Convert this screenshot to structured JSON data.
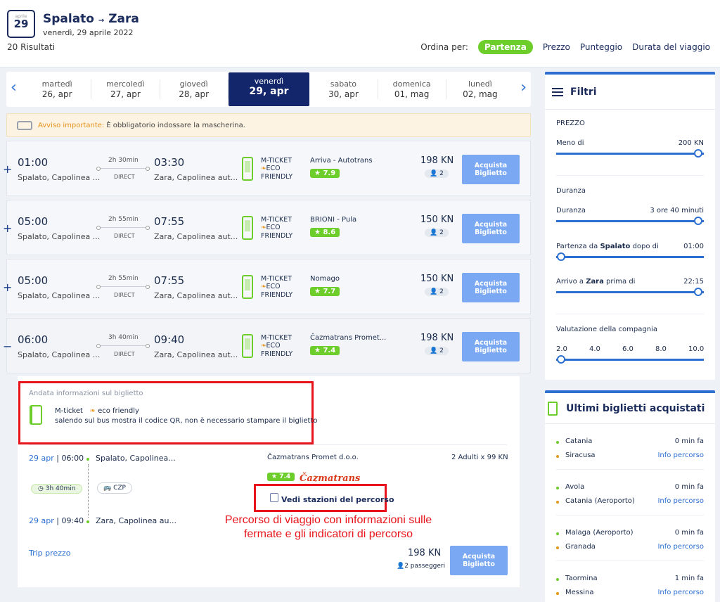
{
  "header": {
    "cal_month": "aprile",
    "cal_day": "29",
    "from": "Spalato",
    "arrow": "→",
    "to": "Zara",
    "date": "venerdì, 29 aprile 2022",
    "results": "20 Risultati",
    "sort_label": "Ordina per:",
    "sort_options": [
      "Partenza",
      "Prezzo",
      "Punteggio",
      "Durata del viaggio"
    ]
  },
  "days": [
    {
      "n": "martedì",
      "d": "26, apr"
    },
    {
      "n": "mercoledì",
      "d": "27, apr"
    },
    {
      "n": "giovedì",
      "d": "28, apr"
    },
    {
      "n": "venerdì",
      "d": "29, apr"
    },
    {
      "n": "sabato",
      "d": "30, apr"
    },
    {
      "n": "domenica",
      "d": "01, mag"
    },
    {
      "n": "lunedì",
      "d": "02, mag"
    }
  ],
  "warning": {
    "label": "Avviso importante:",
    "text": "È obbligatorio indossare la mascherina."
  },
  "trips": [
    {
      "toggle": "+",
      "dep": "01:00",
      "dep_station": "Spalato, Capolinea ...",
      "dur": "2h 30min",
      "direct": "DIRECT",
      "arr": "03:30",
      "arr_station": "Zara, Capolinea aut...",
      "mt1": "M-TICKET",
      "mt2": "ECO",
      "mt3": "FRIENDLY",
      "company": "Arriva - Autotrans",
      "rating": "★ 7.9",
      "price": "198 KN",
      "pax": "2",
      "buy": "Acquista Biglietto"
    },
    {
      "toggle": "+",
      "dep": "05:00",
      "dep_station": "Spalato, Capolinea ...",
      "dur": "2h 55min",
      "direct": "DIRECT",
      "arr": "07:55",
      "arr_station": "Zara, Capolinea aut...",
      "mt1": "M-TICKET",
      "mt2": "ECO",
      "mt3": "FRIENDLY",
      "company": "BRIONI - Pula",
      "rating": "★ 8.6",
      "price": "150 KN",
      "pax": "2",
      "buy": "Acquista Biglietto"
    },
    {
      "toggle": "+",
      "dep": "05:00",
      "dep_station": "Spalato, Capolinea ...",
      "dur": "2h 55min",
      "direct": "DIRECT",
      "arr": "07:55",
      "arr_station": "Zara, Capolinea aut...",
      "mt1": "M-TICKET",
      "mt2": "ECO",
      "mt3": "FRIENDLY",
      "company": "Nomago",
      "rating": "★ 7.7",
      "price": "150 KN",
      "pax": "2",
      "buy": "Acquista Biglietto"
    },
    {
      "toggle": "−",
      "dep": "06:00",
      "dep_station": "Spalato, Capolinea ...",
      "dur": "3h 40min",
      "direct": "DIRECT",
      "arr": "09:40",
      "arr_station": "Zara, Capolinea aut...",
      "mt1": "M-TICKET",
      "mt2": "ECO",
      "mt3": "FRIENDLY",
      "company": "Čazmatrans Promet...",
      "rating": "★ 7.4",
      "price": "198 KN",
      "pax": "2",
      "buy": "Acquista Biglietto"
    }
  ],
  "detail": {
    "info_title": "Andata informazioni sul biglietto",
    "mticket": "M-ticket",
    "eco": "eco friendly",
    "qr_text": "salendo sul bus mostra il codice QR, non è necessario stampare il biglietto",
    "dep_date": "29 apr",
    "dep_time": "06:00",
    "dep_station": "Spalato, Capolinea...",
    "duration": "3h 40min",
    "bus": "CZP",
    "arr_date": "29 apr",
    "arr_time": "09:40",
    "arr_station": "Zara, Capolinea au...",
    "company": "Čazmatrans Promet d.o.o.",
    "adults": "2 Adulti x 99 KN",
    "rating": "★ 7.4",
    "logo": "Čazmatrans",
    "stations": "Vedi stazioni del percorso",
    "annotation": "Percorso di viaggio con informazioni sulle fermate e gli indicatori di percorso",
    "trip_price_label": "Trip prezzo",
    "total": "198 KN",
    "passengers": "2 passeggeri",
    "buy": "Acquista Biglietto"
  },
  "filters": {
    "title": "Filtri",
    "price_section": "PREZZO",
    "price_label": "Meno di",
    "price_value": "200 KN",
    "duration_section": "Duranza",
    "duration_label": "Duranza",
    "duration_value": "3 ore 40 minuti",
    "dep_label_a": "Partenza da ",
    "dep_city": "Spalato",
    "dep_label_b": " dopo di",
    "dep_value": "01:00",
    "arr_label_a": "Arrivo a ",
    "arr_city": "Zara",
    "arr_label_b": " prima di",
    "arr_value": "22:15",
    "rating_section": "Valutazione della compagnia",
    "rating_ticks": [
      "2.0",
      "4.0",
      "6.0",
      "8.0",
      "10.0"
    ]
  },
  "recent": {
    "title": "Ultimi biglietti acquistati",
    "items": [
      {
        "from": "Catania",
        "to": "Siracusa",
        "time": "0 min fa",
        "info": "Info percorso"
      },
      {
        "from": "Avola",
        "to": "Catania (Aeroporto)",
        "time": "0 min fa",
        "info": "Info percorso"
      },
      {
        "from": "Malaga (Aeroporto)",
        "to": "Granada",
        "time": "0 min fa",
        "info": "Info percorso"
      },
      {
        "from": "Taormina",
        "to": "Messina",
        "time": "1 min fa",
        "info": "Info percorso"
      }
    ]
  },
  "colors": {
    "accent": "#2c6fd1",
    "green": "#6ccd2b",
    "navy": "#13256b",
    "red": "#e8141c"
  }
}
